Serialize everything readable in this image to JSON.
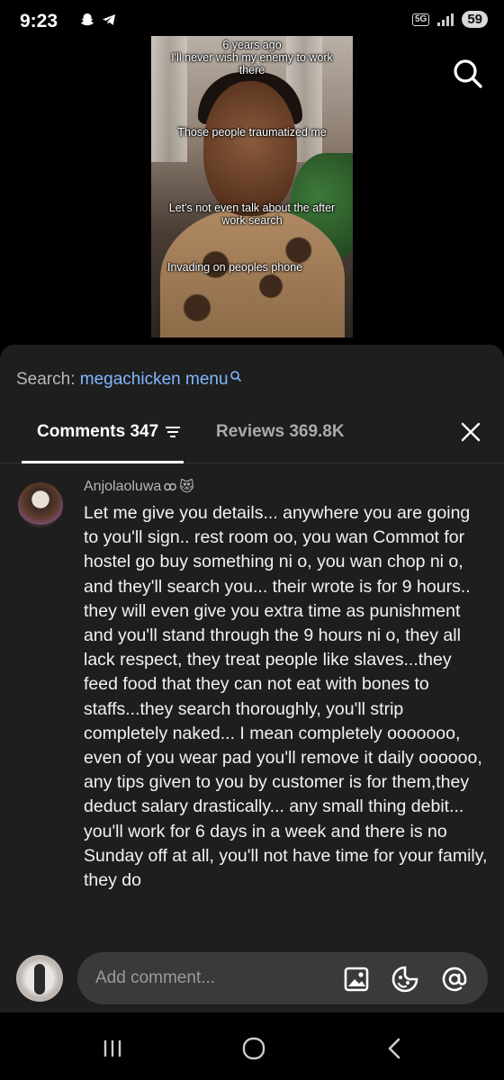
{
  "status_bar": {
    "time": "9:23",
    "network": "5G",
    "battery": "59"
  },
  "video": {
    "captions": [
      "6 years ago",
      "I'll never wish my enemy to work there",
      "Those people traumatized me",
      "Let's not even talk about the after work search",
      "Invading on peoples phone"
    ]
  },
  "sheet": {
    "search_label": "Search:",
    "search_term": "megachicken menu",
    "tabs": {
      "comments_label": "Comments 347",
      "reviews_label": "Reviews 369.8K"
    }
  },
  "comment": {
    "username": "Anjolaoluwa",
    "emoji": "😻",
    "text": "Let me give you details... anywhere you are going to you'll sign.. rest room oo, you wan Commot for hostel go buy something ni o, you wan chop ni o, and they'll search you... their wrote is for 9 hours.. they will even give you extra time as punishment and you'll stand through the 9 hours ni o, they all lack respect, they treat people like slaves...they feed food that they can not eat with bones to staffs...they search thoroughly, you'll strip completely naked... I mean completely ooooooo, even of you wear pad you'll remove it daily oooooo, any tips given to you by customer is for them,they deduct salary drastically... any small thing debit... you'll work for 6 days in a week and there is no Sunday off at all, you'll not have time for your family, they do"
  },
  "input": {
    "placeholder": "Add comment..."
  },
  "icons": {
    "search": "search-icon",
    "close": "close-icon",
    "filter": "filter-icon",
    "image": "image-icon",
    "emoji": "emoji-icon",
    "mention": "at-icon"
  },
  "colors": {
    "link": "#7fb8ff",
    "sheet_bg": "#1e1e1e",
    "input_bg": "#3a3a3a"
  }
}
